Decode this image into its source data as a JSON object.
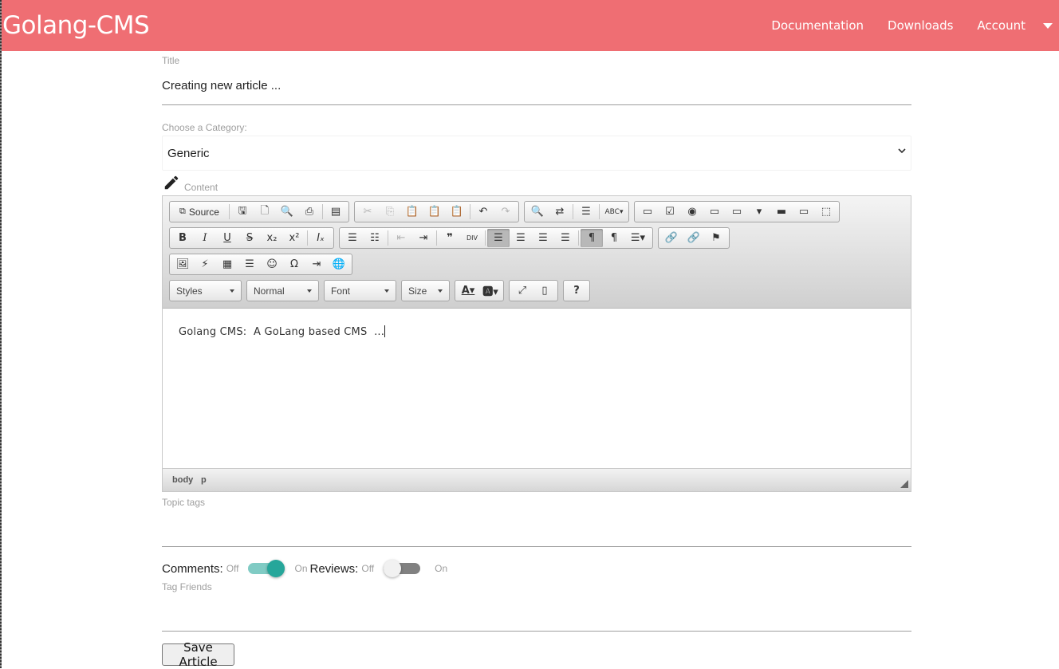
{
  "navbar": {
    "brand": "Golang-CMS",
    "links": [
      "Documentation",
      "Downloads",
      "Account"
    ],
    "bg_color": "#ef6e73"
  },
  "form": {
    "title_label": "Title",
    "title_value": "Creating new article ...",
    "category_label": "Choose a Category:",
    "category_value": "Generic",
    "content_label": "Content",
    "topic_tags_label": "Topic tags",
    "comments_label": "Comments:",
    "reviews_label": "Reviews:",
    "off_label": "Off",
    "on_label": "On",
    "comments_on": true,
    "reviews_on": false,
    "tag_friends_label": "Tag Friends",
    "save_label": "Save Article",
    "accent_color": "#26a69a"
  },
  "editor": {
    "source_label": "Source",
    "combos": [
      "Styles",
      "Normal",
      "Font",
      "Size"
    ],
    "text": "Golang CMS:  A GoLang based CMS  ...",
    "path": [
      "body",
      "p"
    ]
  }
}
